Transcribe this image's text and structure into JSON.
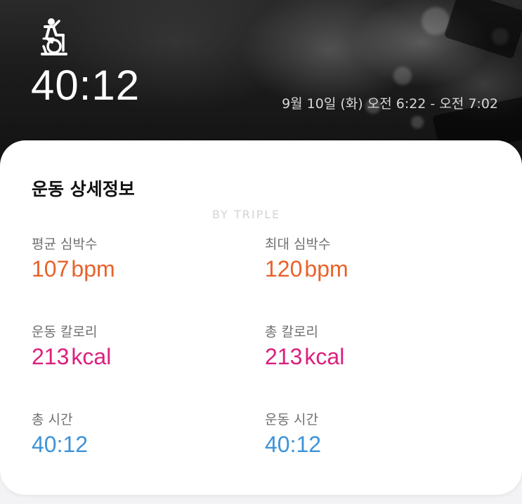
{
  "header": {
    "activity_icon": "stationary-bike-icon",
    "duration": "40:12",
    "time_range": "9월 10일 (화) 오전 6:22 - 오전 7:02"
  },
  "details": {
    "title": "운동 상세정보",
    "watermark": "BY TRIPLE",
    "avg_heart_rate": {
      "label": "평균 심박수",
      "value": "107",
      "unit": "bpm"
    },
    "max_heart_rate": {
      "label": "최대 심박수",
      "value": "120",
      "unit": "bpm"
    },
    "workout_calories": {
      "label": "운동 칼로리",
      "value": "213",
      "unit": "kcal"
    },
    "total_calories": {
      "label": "총 칼로리",
      "value": "213",
      "unit": "kcal"
    },
    "total_time": {
      "label": "총 시간",
      "value": "40:12"
    },
    "workout_time": {
      "label": "운동 시간",
      "value": "40:12"
    }
  },
  "colors": {
    "heart_rate": "#e8622a",
    "calories": "#dc1f7d",
    "time": "#3f93d8"
  }
}
